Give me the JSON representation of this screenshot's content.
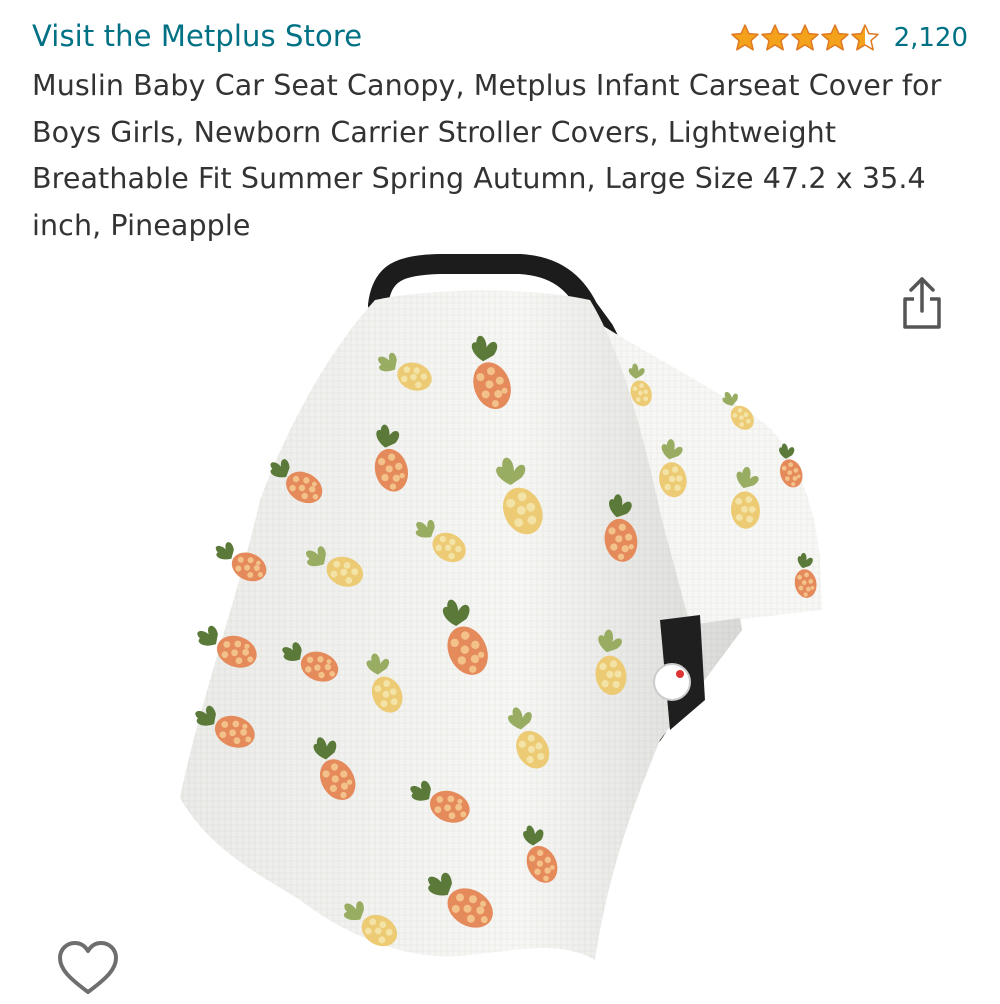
{
  "store": {
    "link_text": "Visit the Metplus Store"
  },
  "rating": {
    "stars": 4.5,
    "max_stars": 5,
    "count": "2,120",
    "star_color": "#f4a21c"
  },
  "product": {
    "title": "Muslin Baby Car Seat Canopy, Metplus Infant Carseat Cover for Boys Girls, Newborn Carrier Stroller Covers, Lightweight Breathable Fit Summer Spring Autumn, Large Size 47.2 x 35.4 inch, Pineapple",
    "image_icon": "product-photo"
  },
  "actions": {
    "share_icon": "share-icon",
    "wishlist_icon": "heart-icon"
  },
  "colors": {
    "link": "#007185",
    "text": "#333333"
  }
}
